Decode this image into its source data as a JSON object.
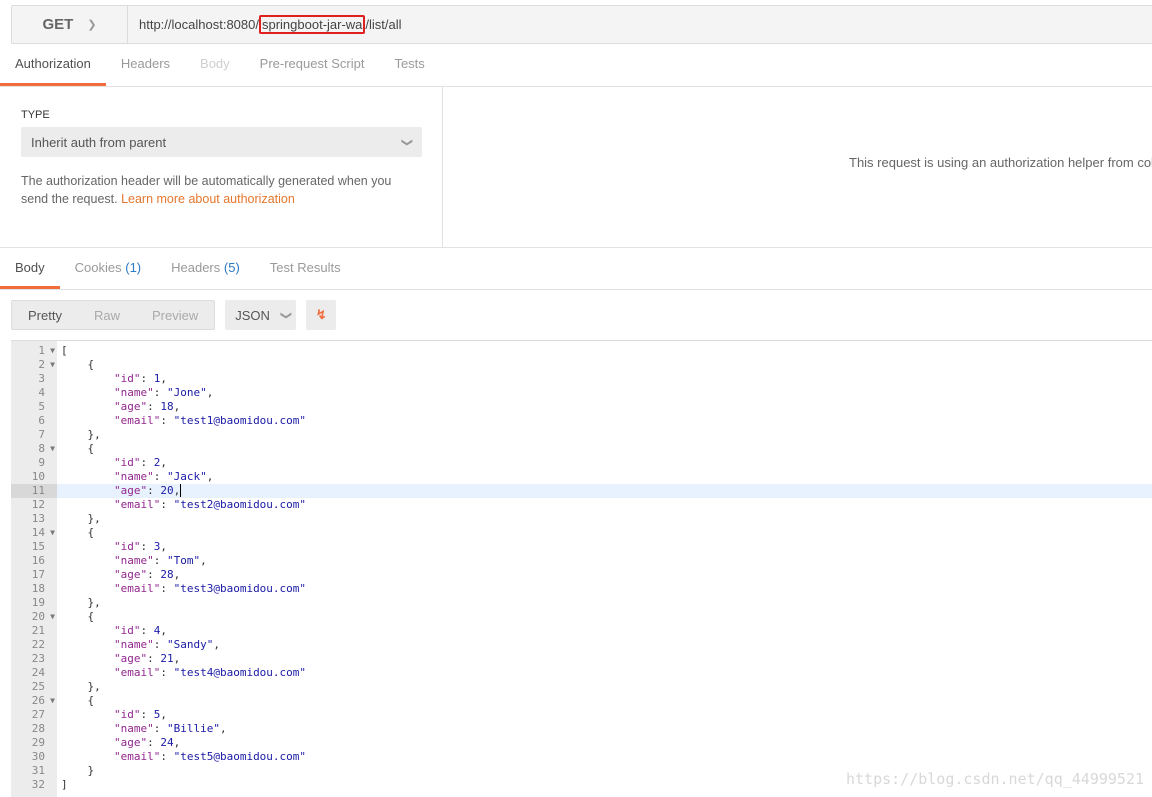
{
  "request": {
    "method": "GET",
    "url_prefix": "http://localhost:8080/",
    "url_highlight": "springboot-jar-wa",
    "url_suffix": "/list/all"
  },
  "request_tabs": [
    {
      "label": "Authorization"
    },
    {
      "label": "Headers"
    },
    {
      "label": "Body"
    },
    {
      "label": "Pre-request Script"
    },
    {
      "label": "Tests"
    }
  ],
  "auth": {
    "type_label": "TYPE",
    "type_value": "Inherit auth from parent",
    "desc": "The authorization header will be automatically generated when you send the request. ",
    "learn_more": "Learn more about authorization",
    "helper_text": "This request is using an authorization helper from colle"
  },
  "response_tabs": [
    {
      "label": "Body"
    },
    {
      "label": "Cookies",
      "count": "(1)"
    },
    {
      "label": "Headers",
      "count": "(5)"
    },
    {
      "label": "Test Results"
    }
  ],
  "view_modes": [
    "Pretty",
    "Raw",
    "Preview"
  ],
  "format": "JSON",
  "users": [
    {
      "id": "1",
      "name": "\"Jone\"",
      "age": "18",
      "email": "\"test1@baomidou.com\""
    },
    {
      "id": "2",
      "name": "\"Jack\"",
      "age": "20",
      "email": "\"test2@baomidou.com\""
    },
    {
      "id": "3",
      "name": "\"Tom\"",
      "age": "28",
      "email": "\"test3@baomidou.com\""
    },
    {
      "id": "4",
      "name": "\"Sandy\"",
      "age": "21",
      "email": "\"test4@baomidou.com\""
    },
    {
      "id": "5",
      "name": "\"Billie\"",
      "age": "24",
      "email": "\"test5@baomidou.com\""
    }
  ],
  "cursor_line": 11,
  "watermark": "https://blog.csdn.net/qq_44999521"
}
